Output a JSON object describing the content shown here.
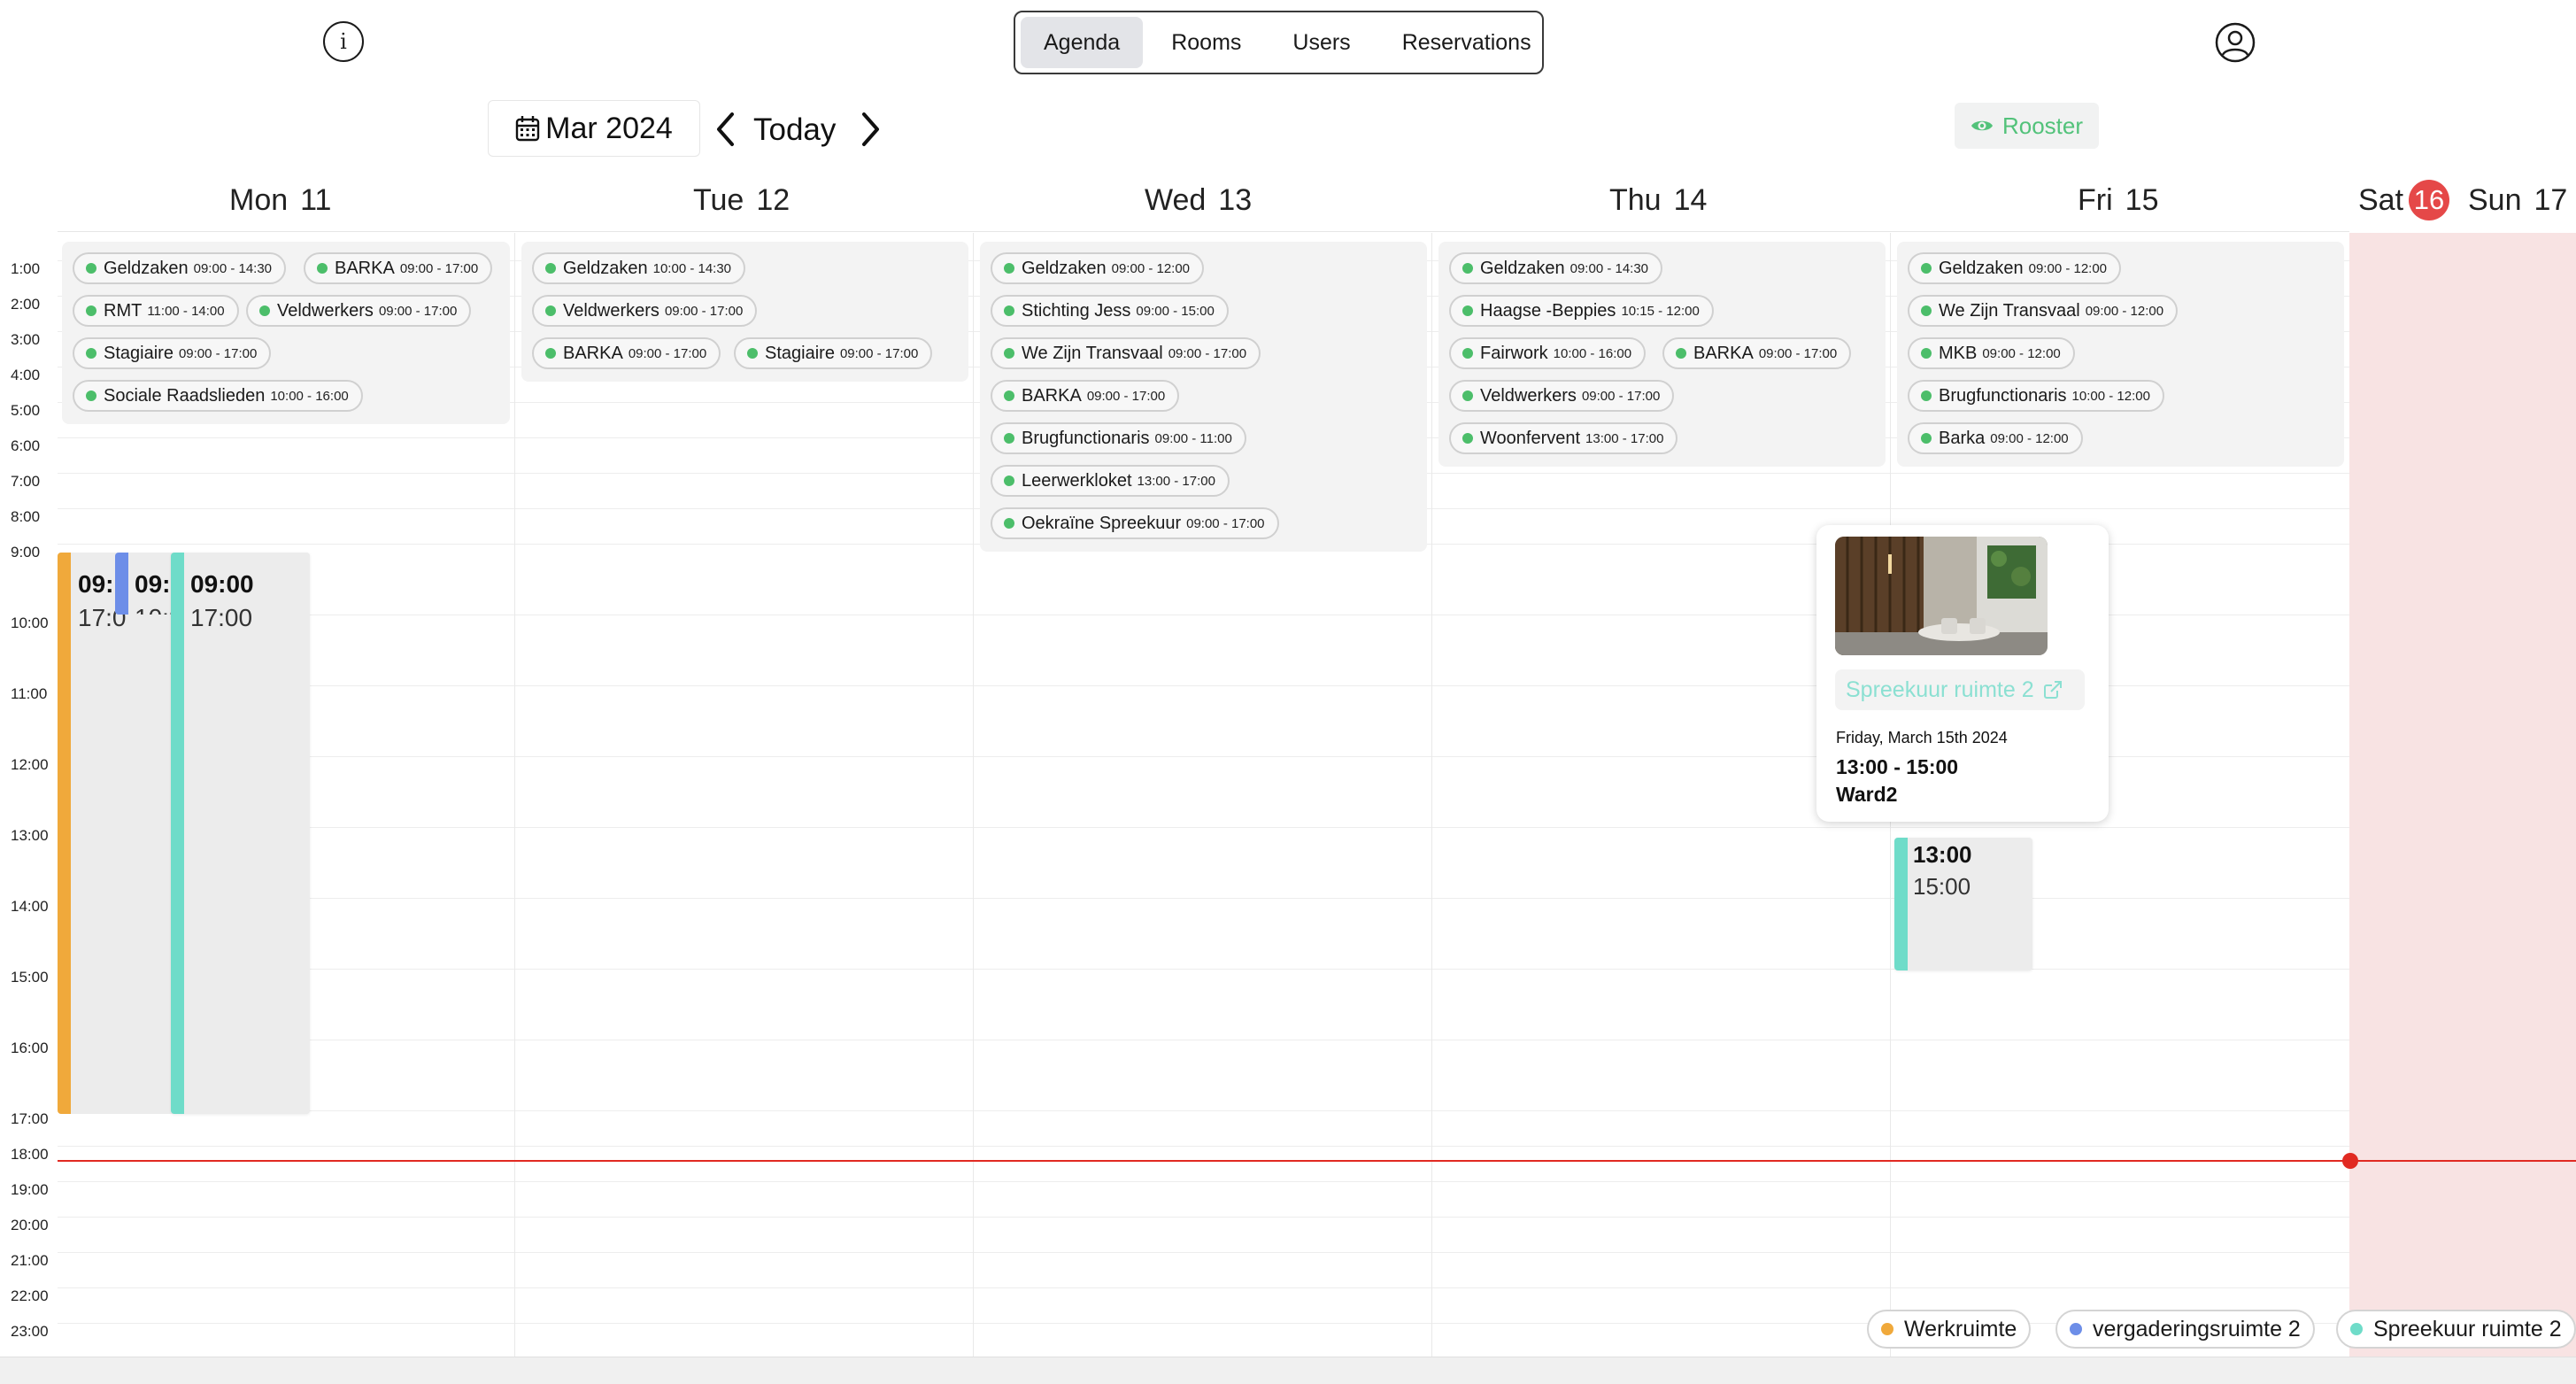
{
  "nav": {
    "tabs": [
      "Agenda",
      "Rooms",
      "Users",
      "Reservations"
    ],
    "active_tab": "Agenda",
    "info_icon_glyph": "i"
  },
  "toolbar": {
    "month_label": "Mar 2024",
    "today_label": "Today",
    "rooster_label": "Rooster"
  },
  "days": [
    {
      "name": "Mon",
      "num": "11"
    },
    {
      "name": "Tue",
      "num": "12"
    },
    {
      "name": "Wed",
      "num": "13"
    },
    {
      "name": "Thu",
      "num": "14"
    },
    {
      "name": "Fri",
      "num": "15"
    },
    {
      "name": "Sat",
      "num": "16"
    },
    {
      "name": "Sun",
      "num": "17"
    }
  ],
  "hours": [
    "1:00",
    "2:00",
    "3:00",
    "4:00",
    "5:00",
    "6:00",
    "7:00",
    "8:00",
    "9:00",
    "10:00",
    "11:00",
    "12:00",
    "13:00",
    "14:00",
    "15:00",
    "16:00",
    "17:00",
    "18:00",
    "19:00",
    "20:00",
    "21:00",
    "22:00",
    "23:00"
  ],
  "all_day": {
    "mon": [
      {
        "name": "Geldzaken",
        "time": "09:00 - 14:30"
      },
      {
        "name": "BARKA",
        "time": "09:00 - 17:00"
      },
      {
        "name": "RMT",
        "time": "11:00 - 14:00"
      },
      {
        "name": "Veldwerkers",
        "time": "09:00 - 17:00"
      },
      {
        "name": "Stagiaire",
        "time": "09:00 - 17:00"
      },
      {
        "name": "Sociale Raadslieden",
        "time": "10:00 - 16:00"
      }
    ],
    "tue": [
      {
        "name": "Geldzaken",
        "time": "10:00 - 14:30"
      },
      {
        "name": "Veldwerkers",
        "time": "09:00 - 17:00"
      },
      {
        "name": "BARKA",
        "time": "09:00 - 17:00"
      },
      {
        "name": "Stagiaire",
        "time": "09:00 - 17:00"
      }
    ],
    "wed": [
      {
        "name": "Geldzaken",
        "time": "09:00 - 12:00"
      },
      {
        "name": "Stichting Jess",
        "time": "09:00 - 15:00"
      },
      {
        "name": "We Zijn Transvaal",
        "time": "09:00 - 17:00"
      },
      {
        "name": "BARKA",
        "time": "09:00 - 17:00"
      },
      {
        "name": "Brugfunctionaris",
        "time": "09:00 - 11:00"
      },
      {
        "name": "Leerwerkloket",
        "time": "13:00 - 17:00"
      },
      {
        "name": "Oekraïne Spreekuur",
        "time": "09:00 - 17:00"
      }
    ],
    "thu": [
      {
        "name": "Geldzaken",
        "time": "09:00 - 14:30"
      },
      {
        "name": "Haagse -Beppies",
        "time": "10:15 - 12:00"
      },
      {
        "name": "Fairwork",
        "time": "10:00 - 16:00"
      },
      {
        "name": "BARKA",
        "time": "09:00 - 17:00"
      },
      {
        "name": "Veldwerkers",
        "time": "09:00 - 17:00"
      },
      {
        "name": "Woonfervent",
        "time": "13:00 - 17:00"
      }
    ],
    "fri": [
      {
        "name": "Geldzaken",
        "time": "09:00 - 12:00"
      },
      {
        "name": "We Zijn Transvaal",
        "time": "09:00 - 12:00"
      },
      {
        "name": "MKB",
        "time": "09:00 - 12:00"
      },
      {
        "name": "Brugfunctionaris",
        "time": "10:00 - 12:00"
      },
      {
        "name": "Barka",
        "time": "09:00 - 12:00"
      }
    ]
  },
  "timed_events": [
    {
      "day": "Mon",
      "start": "09:00",
      "end": "17:00",
      "start_label": "09:",
      "end_label": "17:0",
      "room": "Werkruimte"
    },
    {
      "day": "Mon",
      "start": "09:00",
      "end": "10:00",
      "start_label": "09:",
      "end_label": "10:0",
      "room": "vergaderingsruimte 2"
    },
    {
      "day": "Mon",
      "start": "09:00",
      "end": "17:00",
      "start_label": "09:00",
      "end_label": "17:00",
      "room": "Spreekuur ruimte 2"
    },
    {
      "day": "Fri",
      "start": "13:00",
      "end": "15:00",
      "start_label": "13:00",
      "end_label": "15:00",
      "room": "Spreekuur ruimte 2"
    }
  ],
  "popover": {
    "room_name": "Spreekuur ruimte 2",
    "date": "Friday, March 15th 2024",
    "time": "13:00 - 15:00",
    "user": "Ward2"
  },
  "legend": [
    {
      "label": "Werkruimte",
      "color": "#f0a93b"
    },
    {
      "label": "vergaderingsruimte 2",
      "color": "#6d8ee8"
    },
    {
      "label": "Spreekuur ruimte 2",
      "color": "#6fdcc9"
    }
  ],
  "colors": {
    "accent_green": "#4cbe6a",
    "now_line": "#e12a22",
    "today_badge": "#e54848",
    "weekend_bg": "#f8e3e3"
  },
  "icons": {
    "info": "info-icon",
    "user": "user-circle-icon",
    "calendar": "calendar-icon",
    "prev": "chevron-left-icon",
    "next": "chevron-right-icon",
    "eye": "eye-icon",
    "external_link": "external-link-icon"
  }
}
